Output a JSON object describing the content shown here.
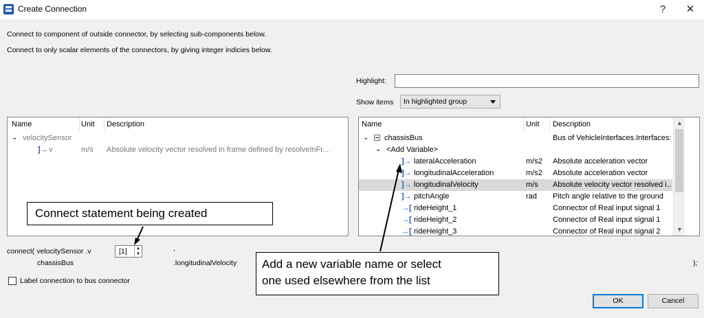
{
  "window": {
    "title": "Create Connection",
    "help_label": "?",
    "close_label": "✕"
  },
  "info": {
    "line1": "Connect to component of outside connector, by selecting sub-components below.",
    "line2": "Connect to only scalar elements of the connectors, by giving integer indicies below."
  },
  "highlight": {
    "label": "Highlight:",
    "value": ""
  },
  "show_items": {
    "label": "Show items",
    "selected": "In highlighted group"
  },
  "left_tree": {
    "headers": {
      "name": "Name",
      "unit": "Unit",
      "description": "Description"
    },
    "rows": [
      {
        "name": "velocitySensor",
        "unit": "",
        "description": ""
      },
      {
        "name": "v",
        "unit": "m/s",
        "description": "Absolute velocity vector resolved in frame defined by resolveInFr..."
      }
    ]
  },
  "right_tree": {
    "headers": {
      "name": "Name",
      "unit": "Unit",
      "description": "Description"
    },
    "rows": [
      {
        "name": "chassisBus",
        "unit": "",
        "description": "Bus of VehicleInterfaces.Interfaces: ..."
      },
      {
        "name": "<Add Variable>",
        "unit": "",
        "description": ""
      },
      {
        "name": "lateralAcceleration",
        "unit": "m/s2",
        "description": "Absolute acceleration vector"
      },
      {
        "name": "longitudinalAcceleration",
        "unit": "m/s2",
        "description": "Absolute acceleration vector"
      },
      {
        "name": "longitudinalVelocity",
        "unit": "m/s",
        "description": "Absolute velocity vector resolved i..."
      },
      {
        "name": "pitchAngle",
        "unit": "rad",
        "description": "Pitch angle relative to the ground"
      },
      {
        "name": "rideHeight_1",
        "unit": "",
        "description": "Connector of Real input signal 1"
      },
      {
        "name": "rideHeight_2",
        "unit": "",
        "description": "Connector of Real input signal 1"
      },
      {
        "name": "rideHeight_3",
        "unit": "",
        "description": "Connector of Real input signal 2"
      }
    ]
  },
  "callouts": {
    "connect": "Connect statement being created",
    "add_variable_line1": "Add a new variable name or select",
    "add_variable_line2": "one used elsewhere from the list"
  },
  "statement": {
    "prefix": "connect( velocitySensor .v",
    "index": "[1]",
    "comma": ",",
    "bus": "chassisBus",
    "member": ".longitudinalVelocity",
    "suffix": ");"
  },
  "label_checkbox": {
    "label": "Label connection to bus connector",
    "checked": false
  },
  "buttons": {
    "ok": "OK",
    "cancel": "Cancel"
  },
  "colors": {
    "connector_icon": "#1f57c8",
    "selection": "#d9d9d9",
    "default_button_border": "#0078d7"
  }
}
